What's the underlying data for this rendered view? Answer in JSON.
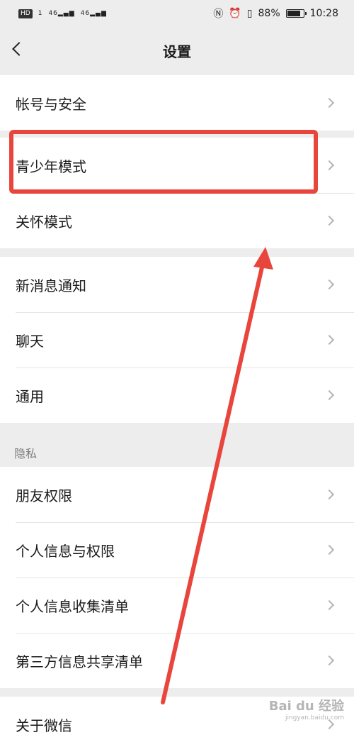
{
  "status_bar": {
    "hd": "HD",
    "sim1": "1",
    "sig1": "46",
    "sig2": "46",
    "battery_text": "88%",
    "battery_level": 0.88,
    "time": "10:28"
  },
  "header": {
    "title": "设置"
  },
  "groups": [
    {
      "items": [
        {
          "label": "帐号与安全"
        }
      ]
    },
    {
      "items": [
        {
          "label": "青少年模式"
        },
        {
          "label": "关怀模式"
        }
      ]
    },
    {
      "items": [
        {
          "label": "新消息通知"
        },
        {
          "label": "聊天"
        },
        {
          "label": "通用"
        }
      ]
    },
    {
      "section": "隐私",
      "items": [
        {
          "label": "朋友权限"
        },
        {
          "label": "个人信息与权限"
        },
        {
          "label": "个人信息收集清单"
        },
        {
          "label": "第三方信息共享清单"
        }
      ]
    },
    {
      "items": [
        {
          "label": "关于微信"
        }
      ]
    }
  ],
  "colors": {
    "annotation": "#e8453c",
    "chevron": "#b4b4b4",
    "background": "#ededed"
  },
  "watermark": {
    "main": "Bai du 经验",
    "sub": "jingyan.baidu.com"
  }
}
